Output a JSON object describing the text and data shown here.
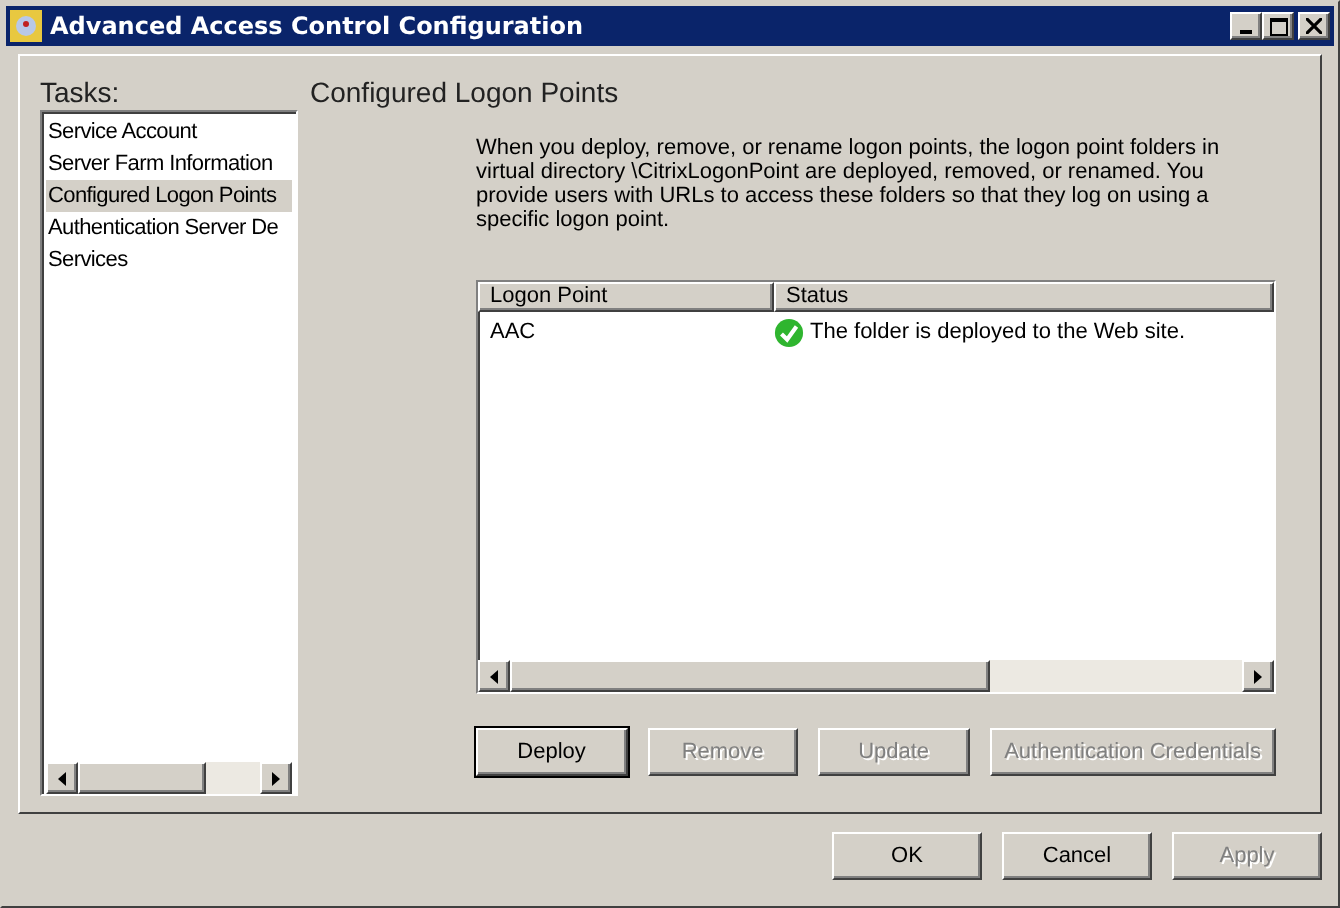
{
  "window": {
    "title": "Advanced Access Control Configuration"
  },
  "tasks": {
    "label": "Tasks:",
    "items": [
      {
        "label": "Service Account",
        "selected": false
      },
      {
        "label": "Server Farm Information",
        "selected": false
      },
      {
        "label": "Configured Logon Points",
        "selected": true
      },
      {
        "label": "Authentication Server De",
        "selected": false
      },
      {
        "label": "Services",
        "selected": false
      }
    ]
  },
  "page": {
    "heading": "Configured Logon Points",
    "description": "When you deploy, remove, or rename logon points, the logon point folders in virtual directory  \\CitrixLogonPoint are deployed, removed, or renamed. You provide users with URLs to access these folders so that they log on using a specific logon point."
  },
  "table": {
    "columns": [
      "Logon Point",
      "Status"
    ],
    "rows": [
      {
        "logon_point": "AAC",
        "status": "The folder is deployed to the Web site.",
        "deployed": true
      }
    ]
  },
  "actions": [
    {
      "label": "Deploy",
      "disabled": false,
      "focused": true
    },
    {
      "label": "Remove",
      "disabled": true,
      "focused": false
    },
    {
      "label": "Update",
      "disabled": true,
      "focused": false
    },
    {
      "label": "Authentication Credentials",
      "disabled": true,
      "focused": false
    }
  ],
  "dialog_buttons": [
    {
      "label": "OK",
      "disabled": false
    },
    {
      "label": "Cancel",
      "disabled": false
    },
    {
      "label": "Apply",
      "disabled": true
    }
  ]
}
